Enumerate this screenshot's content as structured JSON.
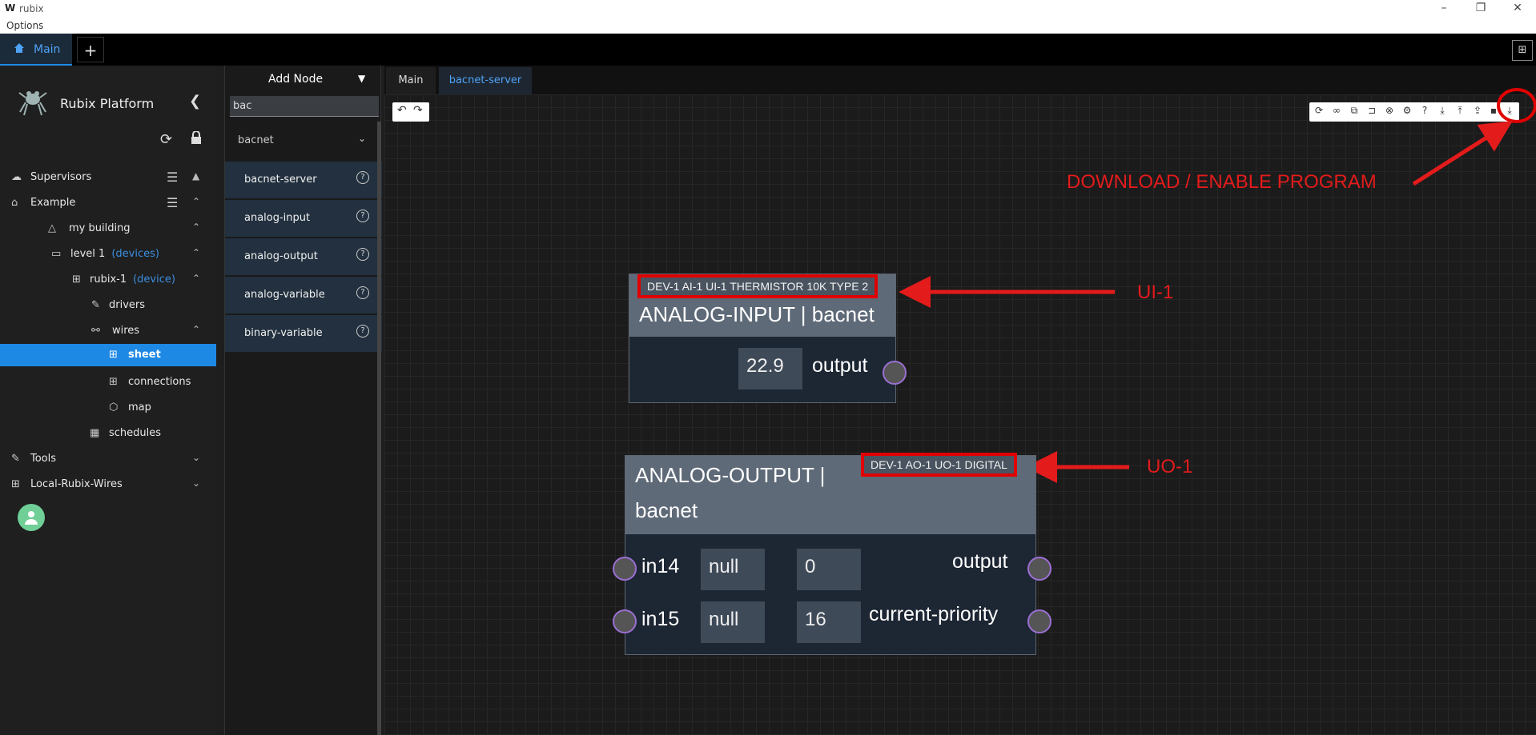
{
  "window": {
    "logo": "W",
    "title": "rubix",
    "minimize": "–",
    "restore": "❐",
    "close": "✕"
  },
  "menu": {
    "options": "Options"
  },
  "tabs": {
    "main_label": "Main",
    "plus": "+",
    "right_icon": "⊞"
  },
  "sidebar": {
    "brand": "Rubix Platform",
    "items": [
      {
        "label": "Supervisors",
        "sub": ""
      },
      {
        "label": "Example",
        "sub": ""
      },
      {
        "label": "my building",
        "sub": ""
      },
      {
        "label": "level 1",
        "sub": "(devices)"
      },
      {
        "label": "rubix-1",
        "sub": "(device)"
      },
      {
        "label": "drivers",
        "sub": ""
      },
      {
        "label": "wires",
        "sub": ""
      },
      {
        "label": "sheet",
        "sub": ""
      },
      {
        "label": "connections",
        "sub": ""
      },
      {
        "label": "map",
        "sub": ""
      },
      {
        "label": "schedules",
        "sub": ""
      },
      {
        "label": "Tools",
        "sub": ""
      },
      {
        "label": "Local-Rubix-Wires",
        "sub": ""
      }
    ]
  },
  "node_panel": {
    "add_node": "Add Node",
    "search_value": "bac",
    "category": "bacnet",
    "nodes": [
      "bacnet-server",
      "analog-input",
      "analog-output",
      "analog-variable",
      "binary-variable"
    ]
  },
  "editor": {
    "tabs": [
      "Main",
      "bacnet-server"
    ]
  },
  "annotations": {
    "download": "DOWNLOAD / ENABLE PROGRAM",
    "ui1": "UI-1",
    "uo1": "UO-1",
    "arrow_color": "#e31b1b"
  },
  "node_ai": {
    "label": "DEV-1 AI-1 UI-1 THERMISTOR 10K TYPE 2",
    "title": "ANALOG-INPUT | bacnet",
    "value": "22.9",
    "output": "output"
  },
  "node_ao": {
    "label": "DEV-1 AO-1 UO-1 DIGITAL",
    "title_line1": "ANALOG-OUTPUT |",
    "title_line2": "bacnet",
    "in14": "in14",
    "in14_val": "null",
    "out_val": "0",
    "output": "output",
    "in15": "in15",
    "in15_val": "null",
    "cp_val": "16",
    "current_priority": "current-priority"
  }
}
